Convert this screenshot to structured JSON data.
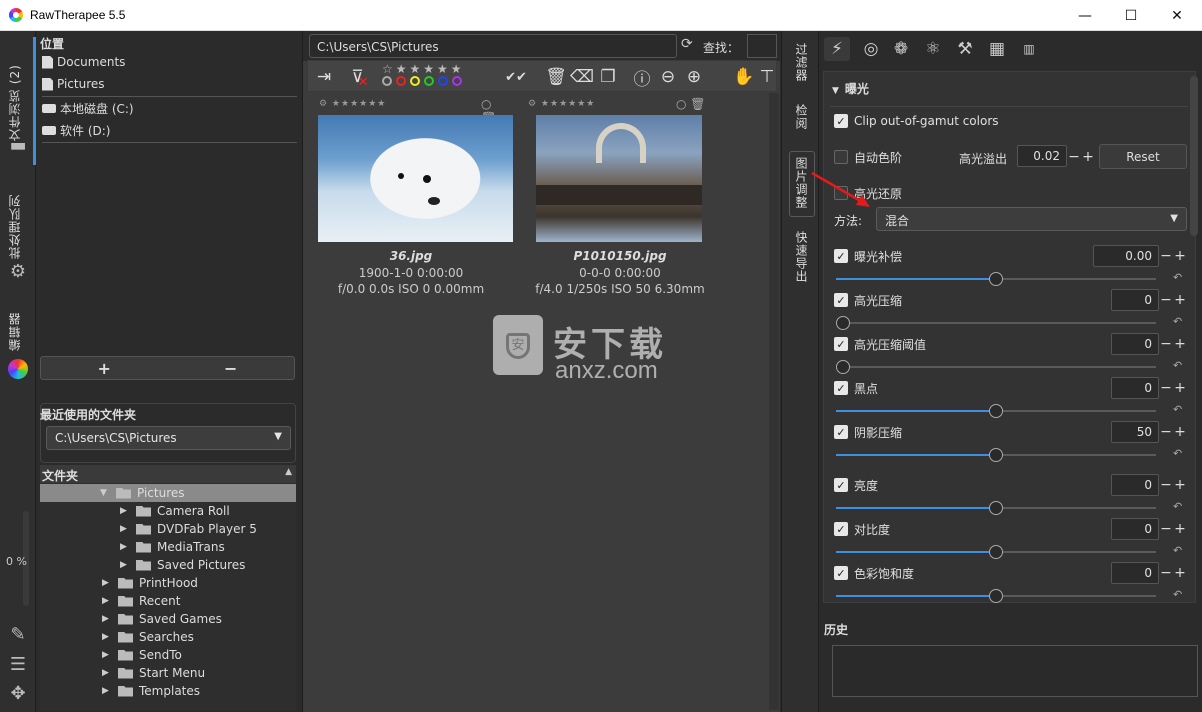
{
  "window": {
    "title": "RawTherapee 5.5",
    "minimize": "—",
    "maximize": "☐",
    "close": "✕"
  },
  "left_strip": {
    "file_browser_tab": "文件浏览 (2)",
    "queue_tab": "批处理队列",
    "editor_tab": "编辑器",
    "progress": "0 %"
  },
  "places": {
    "header": "位置",
    "items": [
      "Documents",
      "Pictures"
    ],
    "drives": [
      "本地磁盘 (C:)",
      "软件 (D:)"
    ],
    "add_label": "+",
    "remove_label": "−"
  },
  "recent": {
    "header": "最近使用的文件夹",
    "selected": "C:\\Users\\CS\\Pictures"
  },
  "folders": {
    "header": "文件夹",
    "tree": [
      {
        "label": "Pictures",
        "level": 1,
        "expanded": true,
        "selected": true
      },
      {
        "label": "Camera Roll",
        "level": 2
      },
      {
        "label": "DVDFab Player 5",
        "level": 2
      },
      {
        "label": "MediaTrans",
        "level": 2
      },
      {
        "label": "Saved Pictures",
        "level": 2
      },
      {
        "label": "PrintHood",
        "level": 1
      },
      {
        "label": "Recent",
        "level": 1
      },
      {
        "label": "Saved Games",
        "level": 1
      },
      {
        "label": "Searches",
        "level": 1
      },
      {
        "label": "SendTo",
        "level": 1
      },
      {
        "label": "Start Menu",
        "level": 1
      },
      {
        "label": "Templates",
        "level": 1
      }
    ]
  },
  "browser": {
    "path": "C:\\Users\\CS\\Pictures",
    "find_label": "查找：",
    "thumbnails": [
      {
        "name": "36.jpg",
        "date": "1900-1-0 0:00:00",
        "exif": "f/0.0 0.0s ISO 0 0.00mm"
      },
      {
        "name": "P1010150.jpg",
        "date": "0-0-0 0:00:00",
        "exif": "f/4.0 1/250s ISO 50 6.30mm"
      }
    ]
  },
  "watermark": {
    "text": "安下载",
    "domain": "anxz.com"
  },
  "right_strip": {
    "filter_tab": "过滤器",
    "inspect_tab": "检阅",
    "image_tab": "图片调整",
    "export_tab": "快速导出"
  },
  "exposure": {
    "header": "曝光",
    "clip_label": "Clip out-of-gamut colors",
    "auto_levels_label": "自动色阶",
    "highlight_clip_label": "高光溢出",
    "highlight_clip_value": "0.02",
    "reset_label": "Reset",
    "hl_recovery_label": "高光还原",
    "method_label": "方法:",
    "method_value": "混合",
    "sliders": [
      {
        "label": "曝光补偿",
        "value": "0.00",
        "fraction": 0.5
      },
      {
        "label": "高光压缩",
        "value": "0",
        "fraction": 0.0
      },
      {
        "label": "高光压缩阈值",
        "value": "0",
        "fraction": 0.0
      },
      {
        "label": "黑点",
        "value": "0",
        "fraction": 0.5
      },
      {
        "label": "阴影压缩",
        "value": "50",
        "fraction": 0.5
      },
      {
        "label": "亮度",
        "value": "0",
        "fraction": 0.5
      },
      {
        "label": "对比度",
        "value": "0",
        "fraction": 0.5
      },
      {
        "label": "色彩饱和度",
        "value": "0",
        "fraction": 0.5
      }
    ]
  },
  "history": {
    "header": "历史"
  },
  "colors": {
    "accent": "#3f8fdc",
    "red_arrow": "#e31b1b"
  }
}
